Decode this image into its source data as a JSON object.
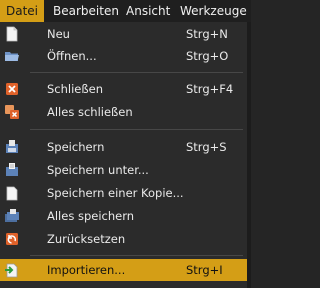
{
  "menubar": {
    "items": [
      {
        "label": "Datei",
        "active": true
      },
      {
        "label": "Bearbeiten"
      },
      {
        "label": "Ansicht"
      },
      {
        "label": "Werkzeuge"
      }
    ]
  },
  "menu": {
    "items": [
      {
        "label": "Neu",
        "shortcut": "Strg+N",
        "icon": "new-file-icon"
      },
      {
        "label": "Öffnen...",
        "shortcut": "Strg+O",
        "icon": "open-folder-icon"
      },
      {
        "label": "Schließen",
        "shortcut": "Strg+F4",
        "icon": "close-icon"
      },
      {
        "label": "Alles schließen",
        "shortcut": "",
        "icon": "close-all-icon"
      },
      {
        "label": "Speichern",
        "shortcut": "Strg+S",
        "icon": "save-icon"
      },
      {
        "label": "Speichern unter...",
        "shortcut": "",
        "icon": "save-as-icon"
      },
      {
        "label": "Speichern einer Kopie...",
        "shortcut": "",
        "icon": "save-copy-icon"
      },
      {
        "label": "Alles speichern",
        "shortcut": "",
        "icon": "save-all-icon"
      },
      {
        "label": "Zurücksetzen",
        "shortcut": "",
        "icon": "revert-icon"
      },
      {
        "label": "Importieren...",
        "shortcut": "Strg+I",
        "icon": "import-icon",
        "highlighted": true
      }
    ]
  },
  "colors": {
    "accent": "#d49e16",
    "menu_bg": "#2b2b2b",
    "menubar_bg": "#1f1f1f"
  }
}
